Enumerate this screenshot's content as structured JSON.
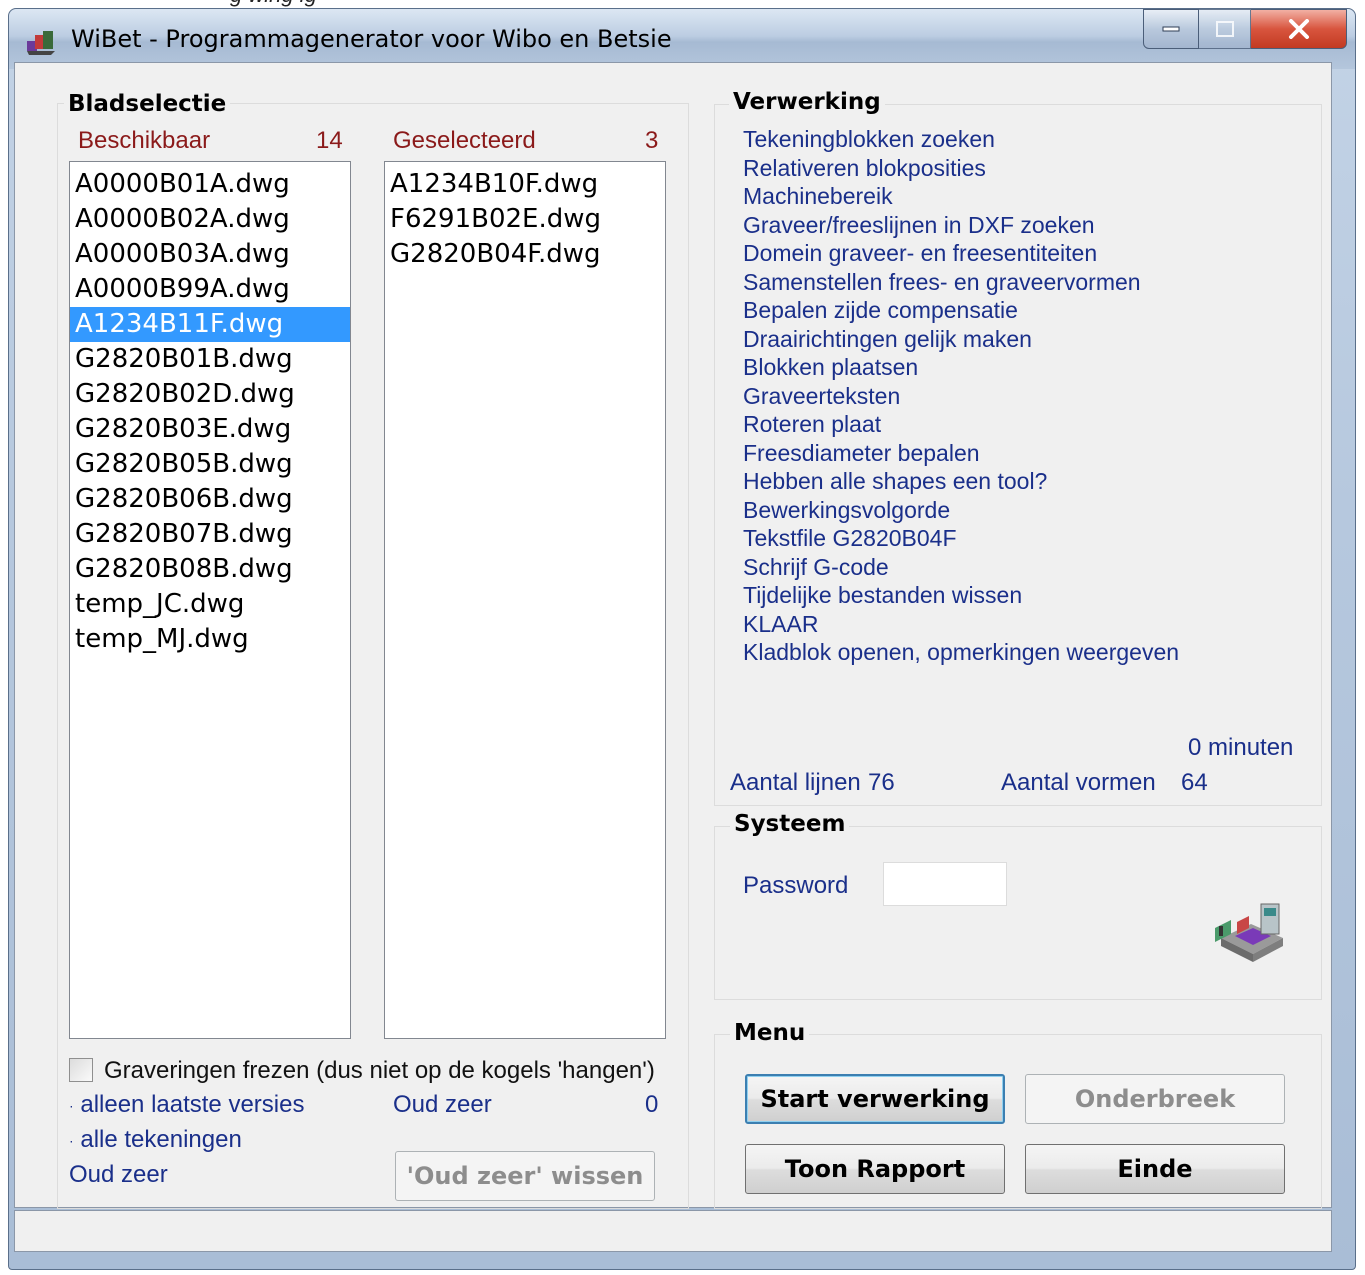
{
  "window": {
    "title": "WiBet - Programmagenerator voor Wibo en Betsie",
    "partial_background_text": "g    wing   ig"
  },
  "bladselectie": {
    "title": "Bladselectie",
    "available_label": "Beschikbaar",
    "available_count": "14",
    "selected_label": "Geselecteerd",
    "selected_count": "3",
    "available_files": [
      "A0000B01A.dwg",
      "A0000B02A.dwg",
      "A0000B03A.dwg",
      "A0000B99A.dwg",
      "A1234B11F.dwg",
      "G2820B01B.dwg",
      "G2820B02D.dwg",
      "G2820B03E.dwg",
      "G2820B05B.dwg",
      "G2820B06B.dwg",
      "G2820B07B.dwg",
      "G2820B08B.dwg",
      "temp_JC.dwg",
      "temp_MJ.dwg"
    ],
    "highlighted_file": "A1234B11F.dwg",
    "selected_files": [
      "A1234B10F.dwg",
      "F6291B02E.dwg",
      "G2820B04F.dwg"
    ],
    "checkbox_label": "Graveringen frezen (dus niet op de kogels 'hangen')",
    "checkbox_checked": false,
    "option_latest": "alleen laatste versies",
    "option_all": "alle tekeningen",
    "oud_zeer_label": "Oud zeer",
    "oud_zeer_count": "0",
    "oud_zeer_bottom_label": "Oud zeer",
    "wissen_button": "'Oud zeer' wissen"
  },
  "verwerking": {
    "title": "Verwerking",
    "steps": [
      "Tekeningblokken zoeken",
      "Relativeren blokposities",
      "Machinebereik",
      "Graveer/freeslijnen in DXF zoeken",
      "Domein graveer- en freesentiteiten",
      "Samenstellen frees- en graveervormen",
      "Bepalen zijde compensatie",
      "Draairichtingen gelijk maken",
      "Blokken plaatsen",
      "Graveerteksten",
      "Roteren plaat",
      "Freesdiameter bepalen",
      "Hebben alle shapes een tool?",
      "Bewerkingsvolgorde",
      "Tekstfile G2820B04F",
      "Schrijf G-code",
      "Tijdelijke bestanden wissen",
      "KLAAR",
      "Kladblok openen, opmerkingen weergeven"
    ],
    "minutes_text": "0 minuten",
    "lines_label": "Aantal lijnen",
    "lines_value": "76",
    "shapes_label": "Aantal vormen",
    "shapes_value": "64"
  },
  "systeem": {
    "title": "Systeem",
    "password_label": "Password",
    "password_value": "",
    "machine_icon": "cnc-machine-icon"
  },
  "menu": {
    "title": "Menu",
    "start_button": "Start verwerking",
    "break_button": "Onderbreek",
    "report_button": "Toon Rapport",
    "exit_button": "Einde"
  },
  "colors": {
    "red_label": "#8b1a1a",
    "blue_label": "#1a2f8a",
    "selection": "#3399ff",
    "close_button": "#d8553e"
  }
}
